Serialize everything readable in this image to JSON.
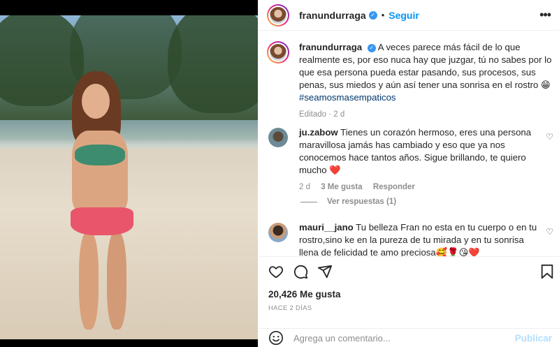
{
  "post": {
    "username": "franundurraga",
    "follow_label": "Seguir",
    "more_icon": "more-horizontal-icon",
    "caption": {
      "username": "franundurraga",
      "text": "A veces parece más fácil de lo que realmente es, por eso nuca hay que juzgar, tú no sabes por lo que esa persona pueda estar pasando, sus procesos, sus penas, sus miedos y aún así tener una sonrisa en el rostro 😁",
      "hashtag": "#seamosmasempaticos",
      "meta": "Editado · 2 d"
    },
    "comments": [
      {
        "username": "ju.zabow",
        "text": "Tienes un corazón hermoso, eres una persona maravillosa jamás has cambiado y eso que ya nos conocemos hace tantos años. Sigue brillando, te quiero mucho ❤️",
        "time": "2 d",
        "likes": "3 Me gusta",
        "reply_label": "Responder",
        "view_replies": "Ver respuestas (1)"
      },
      {
        "username": "mauri__jano",
        "text": "Tu belleza Fran no esta en tu cuerpo o en tu rostro,sino ke en la pureza de tu mirada y en tu sonrisa llena de felicidad te amo preciosa🥰🌹😘❤️"
      }
    ],
    "likes_count": "20,426 Me gusta",
    "time_ago": "HACE 2 DÍAS",
    "comment_placeholder": "Agrega un comentario...",
    "publish_label": "Publicar"
  },
  "colors": {
    "accent": "#0095f6",
    "verified": "#3897f0",
    "muted": "#8e8e8e",
    "publish_disabled": "#b2dffc"
  }
}
